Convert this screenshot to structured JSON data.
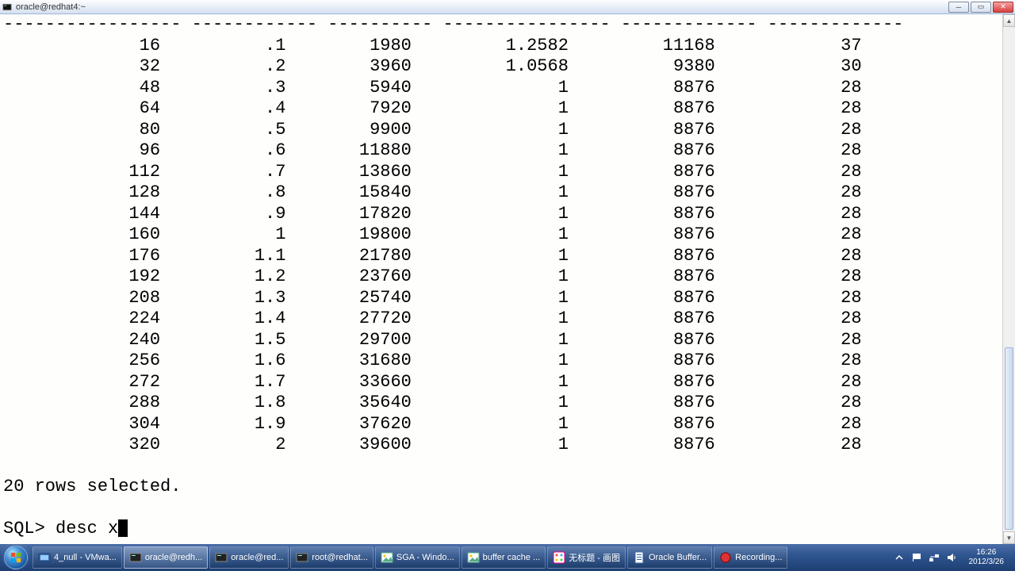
{
  "window": {
    "title": "oracle@redhat4:~"
  },
  "terminal": {
    "divider": "----------------- ------------ ---------- ---------------- ------------- -------------",
    "rows": [
      {
        "c1": "16",
        "c2": ".1",
        "c3": "1980",
        "c4": "1.2582",
        "c5": "11168",
        "c6": "37"
      },
      {
        "c1": "32",
        "c2": ".2",
        "c3": "3960",
        "c4": "1.0568",
        "c5": "9380",
        "c6": "30"
      },
      {
        "c1": "48",
        "c2": ".3",
        "c3": "5940",
        "c4": "1",
        "c5": "8876",
        "c6": "28"
      },
      {
        "c1": "64",
        "c2": ".4",
        "c3": "7920",
        "c4": "1",
        "c5": "8876",
        "c6": "28"
      },
      {
        "c1": "80",
        "c2": ".5",
        "c3": "9900",
        "c4": "1",
        "c5": "8876",
        "c6": "28"
      },
      {
        "c1": "96",
        "c2": ".6",
        "c3": "11880",
        "c4": "1",
        "c5": "8876",
        "c6": "28"
      },
      {
        "c1": "112",
        "c2": ".7",
        "c3": "13860",
        "c4": "1",
        "c5": "8876",
        "c6": "28"
      },
      {
        "c1": "128",
        "c2": ".8",
        "c3": "15840",
        "c4": "1",
        "c5": "8876",
        "c6": "28"
      },
      {
        "c1": "144",
        "c2": ".9",
        "c3": "17820",
        "c4": "1",
        "c5": "8876",
        "c6": "28"
      },
      {
        "c1": "160",
        "c2": "1",
        "c3": "19800",
        "c4": "1",
        "c5": "8876",
        "c6": "28"
      },
      {
        "c1": "176",
        "c2": "1.1",
        "c3": "21780",
        "c4": "1",
        "c5": "8876",
        "c6": "28"
      },
      {
        "c1": "192",
        "c2": "1.2",
        "c3": "23760",
        "c4": "1",
        "c5": "8876",
        "c6": "28"
      },
      {
        "c1": "208",
        "c2": "1.3",
        "c3": "25740",
        "c4": "1",
        "c5": "8876",
        "c6": "28"
      },
      {
        "c1": "224",
        "c2": "1.4",
        "c3": "27720",
        "c4": "1",
        "c5": "8876",
        "c6": "28"
      },
      {
        "c1": "240",
        "c2": "1.5",
        "c3": "29700",
        "c4": "1",
        "c5": "8876",
        "c6": "28"
      },
      {
        "c1": "256",
        "c2": "1.6",
        "c3": "31680",
        "c4": "1",
        "c5": "8876",
        "c6": "28"
      },
      {
        "c1": "272",
        "c2": "1.7",
        "c3": "33660",
        "c4": "1",
        "c5": "8876",
        "c6": "28"
      },
      {
        "c1": "288",
        "c2": "1.8",
        "c3": "35640",
        "c4": "1",
        "c5": "8876",
        "c6": "28"
      },
      {
        "c1": "304",
        "c2": "1.9",
        "c3": "37620",
        "c4": "1",
        "c5": "8876",
        "c6": "28"
      },
      {
        "c1": "320",
        "c2": "2",
        "c3": "39600",
        "c4": "1",
        "c5": "8876",
        "c6": "28"
      }
    ],
    "status": "20 rows selected.",
    "prompt": "SQL> ",
    "command": "desc x"
  },
  "taskbar": {
    "items": [
      {
        "label": "4_null - VMwa...",
        "icon": "vmware"
      },
      {
        "label": "oracle@redh...",
        "icon": "putty",
        "active": true
      },
      {
        "label": "oracle@red...",
        "icon": "putty"
      },
      {
        "label": "root@redhat...",
        "icon": "putty"
      },
      {
        "label": "SGA - Windo...",
        "icon": "image"
      },
      {
        "label": "buffer cache ...",
        "icon": "image"
      },
      {
        "label": "无标题 - 画图",
        "icon": "paint"
      },
      {
        "label": "Oracle Buffer...",
        "icon": "doc"
      },
      {
        "label": "Recording...",
        "icon": "record"
      }
    ],
    "clock": {
      "time": "16:26",
      "date": "2012/3/26"
    }
  }
}
